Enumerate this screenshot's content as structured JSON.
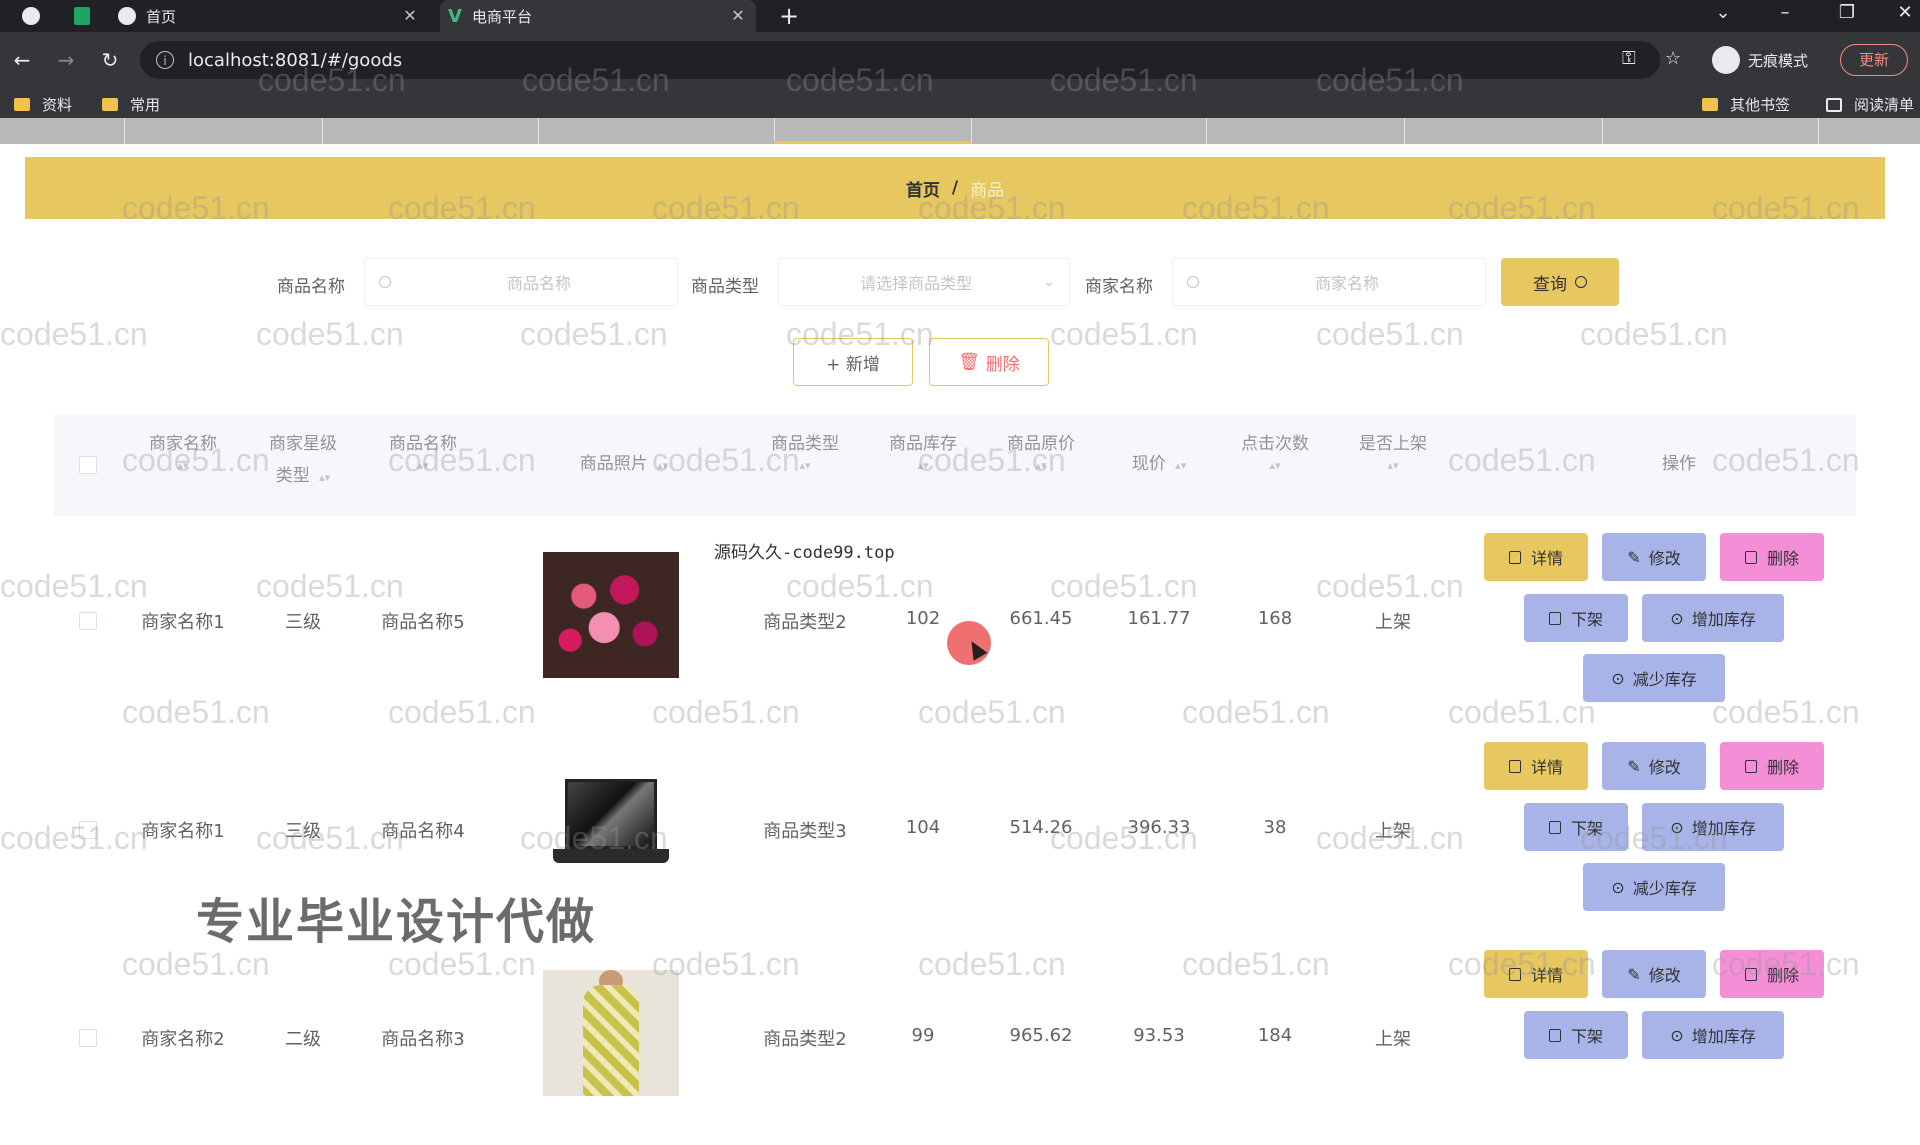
{
  "browser": {
    "tabs": [
      {
        "title": "首页"
      },
      {
        "title": "电商平台"
      }
    ],
    "url": "localhost:8081/#/goods",
    "profile_label": "无痕模式",
    "update_label": "更新",
    "bookmarks": [
      "资料",
      "常用"
    ],
    "bookmarks_right": [
      "其他书签",
      "阅读清单"
    ]
  },
  "breadcrumb": {
    "home": "首页",
    "separator": "/",
    "current": "商品"
  },
  "search": {
    "name_label": "商品名称",
    "name_placeholder": "商品名称",
    "type_label": "商品类型",
    "type_placeholder": "请选择商品类型",
    "merchant_label": "商家名称",
    "merchant_placeholder": "商家名称",
    "query_label": "查询"
  },
  "actions": {
    "add": "+ 新增",
    "delete": "删除"
  },
  "table": {
    "headers": {
      "merchant_name": "商家名称",
      "merchant_level": "商家星级",
      "merchant_level_2": "类型",
      "product_name": "商品名称",
      "product_photo": "商品照片",
      "product_type": "商品类型",
      "stock": "商品库存",
      "original_price": "商品原价",
      "current_price": "现价",
      "clicks": "点击次数",
      "on_shelf": "是否上架",
      "ops": "操作"
    },
    "rows": [
      {
        "merchant_name": "商家名称1",
        "merchant_level": "三级",
        "product_name": "商品名称5",
        "product_type": "商品类型2",
        "stock": "102",
        "original_price": "661.45",
        "current_price": "161.77",
        "clicks": "168",
        "on_shelf": "上架",
        "image": "flowers"
      },
      {
        "merchant_name": "商家名称1",
        "merchant_level": "三级",
        "product_name": "商品名称4",
        "product_type": "商品类型3",
        "stock": "104",
        "original_price": "514.26",
        "current_price": "396.33",
        "clicks": "38",
        "on_shelf": "上架",
        "image": "laptop"
      },
      {
        "merchant_name": "商家名称2",
        "merchant_level": "二级",
        "product_name": "商品名称3",
        "product_type": "商品类型2",
        "stock": "99",
        "original_price": "965.62",
        "current_price": "93.53",
        "clicks": "184",
        "on_shelf": "上架",
        "image": "dress"
      }
    ],
    "row_buttons": {
      "detail": "详情",
      "edit": "修改",
      "delete": "删除",
      "off_shelf": "下架",
      "add_stock": "增加库存",
      "reduce_stock": "减少库存"
    }
  },
  "overlay": {
    "source_text": "源码久久-code99.top",
    "promo": "专业毕业设计代做"
  },
  "watermark": "code51.cn",
  "colors": {
    "accent": "#e6c760",
    "edit": "#a8b4e8",
    "delete": "#f48fd7",
    "danger": "#f56c6c"
  }
}
